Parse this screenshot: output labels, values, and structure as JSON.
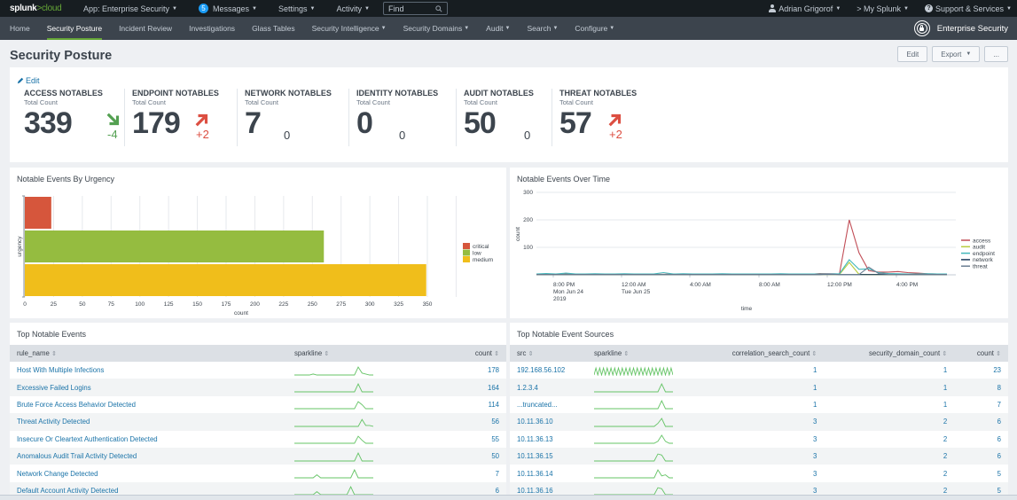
{
  "topbar": {
    "logo_brand": "splunk",
    "logo_sep": ">",
    "logo_product": "cloud",
    "app_label": "App: Enterprise Security",
    "messages_count": "5",
    "messages_label": "Messages",
    "settings_label": "Settings",
    "activity_label": "Activity",
    "find_placeholder": "Find",
    "user_label": "Adrian Grigorof",
    "my_splunk_label": "> My Splunk",
    "support_label": "Support & Services"
  },
  "nav": {
    "items": [
      {
        "label": "Home",
        "dropdown": false
      },
      {
        "label": "Security Posture",
        "dropdown": false,
        "active": true
      },
      {
        "label": "Incident Review",
        "dropdown": false
      },
      {
        "label": "Investigations",
        "dropdown": false
      },
      {
        "label": "Glass Tables",
        "dropdown": false
      },
      {
        "label": "Security Intelligence",
        "dropdown": true
      },
      {
        "label": "Security Domains",
        "dropdown": true
      },
      {
        "label": "Audit",
        "dropdown": true
      },
      {
        "label": "Search",
        "dropdown": true
      },
      {
        "label": "Configure",
        "dropdown": true
      }
    ],
    "app_name": "Enterprise Security"
  },
  "header": {
    "title": "Security Posture",
    "edit_label": "Edit",
    "export_label": "Export",
    "more_label": "..."
  },
  "kpis": {
    "edit_label": "Edit",
    "subtitle": "Total Count",
    "items": [
      {
        "title": "ACCESS NOTABLES",
        "value": "339",
        "delta": "-4",
        "trend": "down",
        "color": "#53a051"
      },
      {
        "title": "ENDPOINT NOTABLES",
        "value": "179",
        "delta": "+2",
        "trend": "up",
        "color": "#dc4e41"
      },
      {
        "title": "NETWORK NOTABLES",
        "value": "7",
        "delta": "0",
        "trend": "none",
        "color": "#3c444d"
      },
      {
        "title": "IDENTITY NOTABLES",
        "value": "0",
        "delta": "0",
        "trend": "none",
        "color": "#3c444d"
      },
      {
        "title": "AUDIT NOTABLES",
        "value": "50",
        "delta": "0",
        "trend": "none",
        "color": "#3c444d"
      },
      {
        "title": "THREAT NOTABLES",
        "value": "57",
        "delta": "+2",
        "trend": "up",
        "color": "#dc4e41"
      }
    ]
  },
  "chart_data": [
    {
      "type": "bar",
      "orientation": "horizontal",
      "title": "Notable Events By Urgency",
      "xlabel": "count",
      "ylabel": "urgency",
      "categories": [
        "critical",
        "low",
        "medium"
      ],
      "values": [
        23,
        260,
        349
      ],
      "colors": [
        "#d6563c",
        "#95bc40",
        "#f0be1b"
      ],
      "xlim": [
        0,
        350
      ],
      "xticks": [
        0,
        25,
        50,
        75,
        100,
        125,
        150,
        175,
        200,
        225,
        250,
        275,
        300,
        325,
        350
      ],
      "grid": true,
      "legend": "right"
    },
    {
      "type": "line",
      "title": "Notable Events Over Time",
      "xlabel": "time",
      "ylabel": "count",
      "ylim": [
        0,
        300
      ],
      "yticks": [
        100,
        200,
        300
      ],
      "xtick_labels": [
        {
          "label": "8:00 PM",
          "sub1": "Mon Jun 24",
          "sub2": "2019"
        },
        {
          "label": "12:00 AM",
          "sub1": "Tue Jun 25",
          "sub2": ""
        },
        {
          "label": "4:00 AM",
          "sub1": "",
          "sub2": ""
        },
        {
          "label": "8:00 AM",
          "sub1": "",
          "sub2": ""
        },
        {
          "label": "12:00 PM",
          "sub1": "",
          "sub2": ""
        },
        {
          "label": "4:00 PM",
          "sub1": "",
          "sub2": ""
        }
      ],
      "x_hours": [
        0,
        1,
        2,
        3,
        4,
        5,
        6,
        7,
        8,
        9,
        10,
        11,
        12,
        13,
        14,
        15,
        16,
        17,
        18,
        19,
        20,
        21,
        22,
        23,
        24,
        25,
        26,
        27,
        28,
        29,
        30,
        31,
        32,
        33,
        34,
        35,
        36,
        37,
        38,
        39,
        40,
        41,
        42
      ],
      "series": [
        {
          "name": "access",
          "color": "#c14d56",
          "values": [
            2,
            3,
            2,
            3,
            2,
            2,
            3,
            2,
            2,
            3,
            2,
            2,
            2,
            2,
            3,
            2,
            2,
            2,
            2,
            3,
            2,
            2,
            2,
            2,
            2,
            3,
            2,
            2,
            2,
            5,
            3,
            3,
            200,
            80,
            15,
            10,
            10,
            12,
            8,
            6,
            4,
            3,
            2
          ]
        },
        {
          "name": "audit",
          "color": "#b8cc3f",
          "values": [
            1,
            1,
            1,
            1,
            1,
            1,
            1,
            1,
            1,
            1,
            1,
            1,
            1,
            1,
            1,
            1,
            1,
            1,
            1,
            1,
            1,
            1,
            1,
            1,
            1,
            1,
            1,
            1,
            1,
            1,
            1,
            1,
            45,
            2,
            1,
            1,
            1,
            1,
            1,
            1,
            1,
            1,
            1
          ]
        },
        {
          "name": "endpoint",
          "color": "#43b8bb",
          "values": [
            3,
            5,
            3,
            6,
            3,
            3,
            4,
            3,
            3,
            4,
            3,
            3,
            3,
            8,
            3,
            4,
            3,
            3,
            3,
            4,
            3,
            3,
            3,
            3,
            3,
            4,
            3,
            3,
            3,
            3,
            3,
            4,
            55,
            20,
            22,
            8,
            5,
            4,
            3,
            3,
            4,
            3,
            3
          ]
        },
        {
          "name": "network",
          "color": "#1d3b5b",
          "values": [
            1,
            1,
            1,
            1,
            1,
            1,
            1,
            1,
            1,
            1,
            1,
            1,
            1,
            1,
            1,
            1,
            1,
            1,
            1,
            1,
            1,
            1,
            1,
            1,
            1,
            1,
            1,
            1,
            1,
            1,
            3,
            1,
            1,
            1,
            1,
            1,
            1,
            1,
            1,
            1,
            1,
            1,
            1
          ]
        },
        {
          "name": "threat",
          "color": "#6b7f93",
          "values": [
            1,
            1,
            1,
            1,
            1,
            1,
            1,
            1,
            1,
            1,
            1,
            1,
            1,
            1,
            1,
            1,
            1,
            1,
            1,
            1,
            1,
            1,
            1,
            1,
            1,
            1,
            1,
            1,
            1,
            1,
            1,
            1,
            1,
            1,
            28,
            5,
            2,
            1,
            1,
            1,
            1,
            1,
            1
          ]
        }
      ],
      "legend": "right"
    }
  ],
  "top_events": {
    "title": "Top Notable Events",
    "columns": [
      "rule_name",
      "sparkline",
      "count"
    ],
    "rows": [
      {
        "rule_name": "Host With Multiple Infections",
        "count": "178",
        "spark": [
          1,
          1,
          1,
          1,
          1,
          2,
          1,
          1,
          1,
          1,
          1,
          1,
          1,
          1,
          1,
          1,
          1,
          9,
          3,
          2,
          1,
          1
        ]
      },
      {
        "rule_name": "Excessive Failed Logins",
        "count": "164",
        "spark": [
          1,
          1,
          1,
          1,
          1,
          1,
          1,
          1,
          1,
          1,
          1,
          1,
          1,
          1,
          1,
          1,
          1,
          9,
          1,
          1,
          1,
          1
        ]
      },
      {
        "rule_name": "Brute Force Access Behavior Detected",
        "count": "114",
        "spark": [
          1,
          1,
          1,
          1,
          1,
          1,
          1,
          1,
          1,
          1,
          1,
          1,
          1,
          1,
          1,
          1,
          1,
          8,
          5,
          1,
          1,
          1
        ]
      },
      {
        "rule_name": "Threat Activity Detected",
        "count": "56",
        "spark": [
          1,
          1,
          1,
          1,
          1,
          1,
          1,
          1,
          1,
          1,
          1,
          1,
          1,
          1,
          1,
          1,
          1,
          1,
          8,
          2,
          2,
          1
        ]
      },
      {
        "rule_name": "Insecure Or Cleartext Authentication Detected",
        "count": "55",
        "spark": [
          1,
          1,
          1,
          1,
          1,
          1,
          1,
          1,
          1,
          1,
          1,
          1,
          1,
          1,
          1,
          1,
          1,
          8,
          4,
          1,
          1,
          1
        ]
      },
      {
        "rule_name": "Anomalous Audit Trail Activity Detected",
        "count": "50",
        "spark": [
          1,
          1,
          1,
          1,
          1,
          1,
          1,
          1,
          1,
          1,
          1,
          1,
          1,
          1,
          1,
          1,
          1,
          9,
          1,
          1,
          1,
          1
        ]
      },
      {
        "rule_name": "Network Change Detected",
        "count": "7",
        "spark": [
          1,
          1,
          1,
          1,
          1,
          1,
          4,
          1,
          1,
          1,
          1,
          1,
          1,
          1,
          1,
          1,
          9,
          1,
          1,
          1,
          1,
          1
        ]
      },
      {
        "rule_name": "Default Account Activity Detected",
        "count": "6",
        "spark": [
          1,
          1,
          1,
          1,
          1,
          1,
          4,
          1,
          1,
          1,
          1,
          1,
          1,
          1,
          1,
          9,
          1,
          1,
          1,
          1,
          1,
          1
        ]
      }
    ]
  },
  "top_sources": {
    "title": "Top Notable Event Sources",
    "columns": [
      "src",
      "sparkline",
      "correlation_search_count",
      "security_domain_count",
      "count"
    ],
    "rows": [
      {
        "src": "192.168.56.102",
        "corr": "1",
        "domain": "1",
        "count": "23",
        "spark": [
          1,
          8,
          1,
          8,
          1,
          8,
          1,
          8,
          1,
          8,
          1,
          8,
          1,
          8,
          1,
          8,
          1,
          8,
          1,
          8,
          1,
          8,
          1,
          8,
          1,
          8,
          1,
          8,
          1,
          8,
          1,
          8,
          1,
          8,
          1,
          8,
          1,
          8,
          1,
          8,
          1,
          8,
          1
        ]
      },
      {
        "src": "1.2.3.4",
        "corr": "1",
        "domain": "1",
        "count": "8",
        "spark": [
          1,
          1,
          1,
          1,
          1,
          1,
          1,
          1,
          1,
          1,
          1,
          1,
          1,
          1,
          1,
          1,
          1,
          1,
          9,
          1,
          1,
          1
        ]
      },
      {
        "src": "...truncated...",
        "corr": "1",
        "domain": "1",
        "count": "7",
        "spark": [
          1,
          1,
          1,
          1,
          1,
          1,
          1,
          1,
          1,
          1,
          1,
          1,
          1,
          1,
          1,
          1,
          1,
          1,
          9,
          1,
          1,
          1
        ]
      },
      {
        "src": "10.11.36.10",
        "corr": "3",
        "domain": "2",
        "count": "6",
        "spark": [
          1,
          1,
          1,
          1,
          1,
          1,
          1,
          1,
          1,
          1,
          1,
          1,
          1,
          1,
          1,
          1,
          1,
          4,
          9,
          1,
          1,
          1
        ]
      },
      {
        "src": "10.11.36.13",
        "corr": "3",
        "domain": "2",
        "count": "6",
        "spark": [
          1,
          1,
          1,
          1,
          1,
          1,
          1,
          1,
          1,
          1,
          1,
          1,
          1,
          1,
          1,
          1,
          1,
          3,
          9,
          3,
          1,
          1
        ]
      },
      {
        "src": "10.11.36.15",
        "corr": "3",
        "domain": "2",
        "count": "6",
        "spark": [
          1,
          1,
          1,
          1,
          1,
          1,
          1,
          1,
          1,
          1,
          1,
          1,
          1,
          1,
          1,
          1,
          1,
          8,
          7,
          1,
          1,
          1
        ]
      },
      {
        "src": "10.11.36.14",
        "corr": "3",
        "domain": "2",
        "count": "5",
        "spark": [
          1,
          1,
          1,
          1,
          1,
          1,
          1,
          1,
          1,
          1,
          1,
          1,
          1,
          1,
          1,
          1,
          1,
          9,
          3,
          4,
          1,
          1
        ]
      },
      {
        "src": "10.11.36.16",
        "corr": "3",
        "domain": "2",
        "count": "5",
        "spark": [
          1,
          1,
          1,
          1,
          1,
          1,
          1,
          1,
          1,
          1,
          1,
          1,
          1,
          1,
          1,
          1,
          1,
          8,
          7,
          1,
          1,
          1
        ]
      }
    ]
  }
}
